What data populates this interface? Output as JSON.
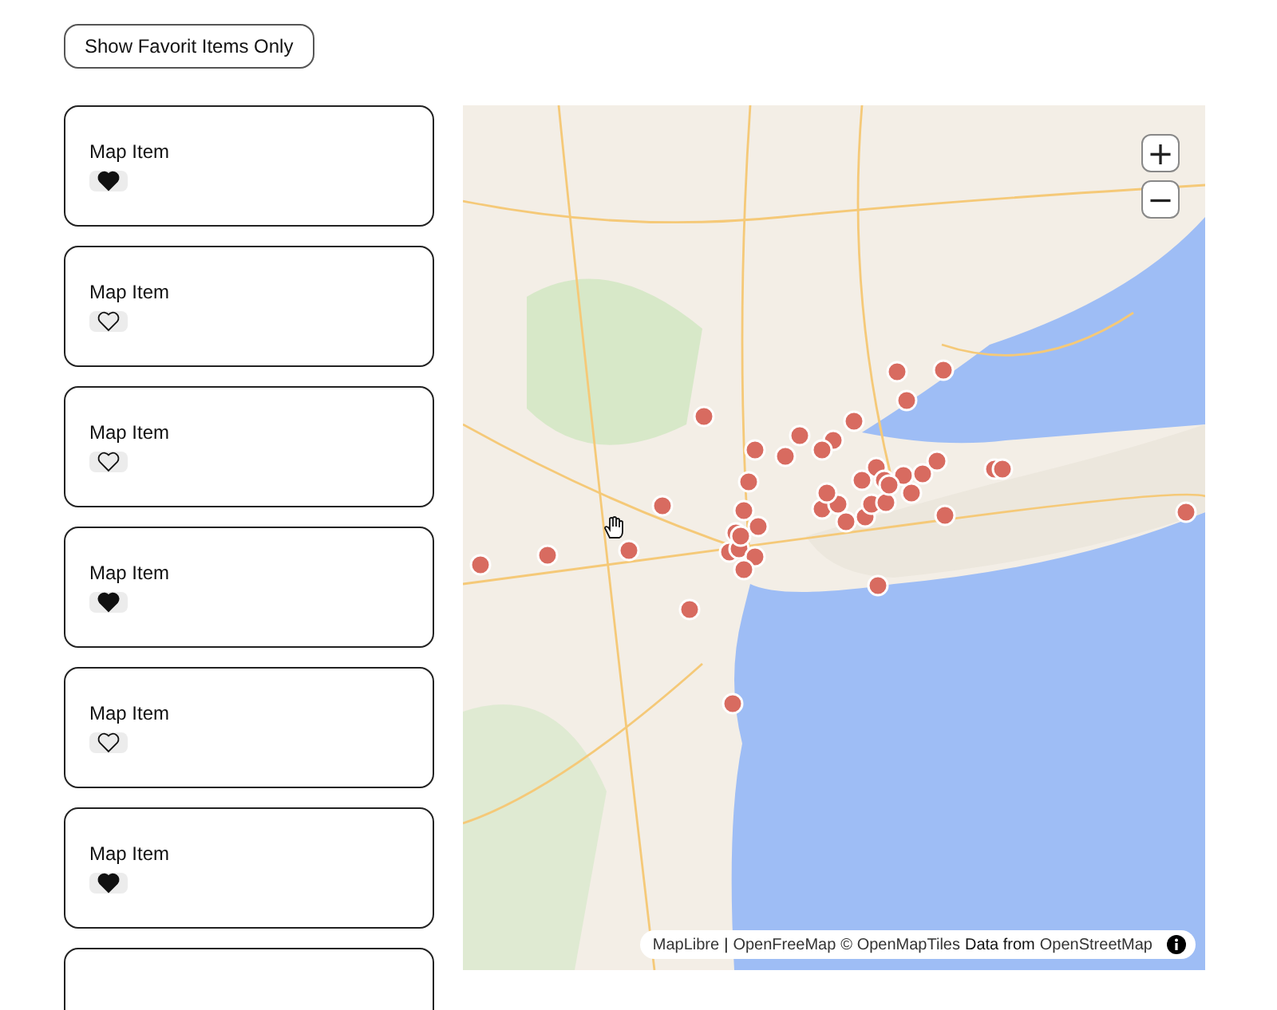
{
  "filter_button": {
    "label": "Show Favorit Items Only"
  },
  "items": [
    {
      "label": "Map Item",
      "favorite": true
    },
    {
      "label": "Map Item",
      "favorite": false
    },
    {
      "label": "Map Item",
      "favorite": false
    },
    {
      "label": "Map Item",
      "favorite": true
    },
    {
      "label": "Map Item",
      "favorite": false
    },
    {
      "label": "Map Item",
      "favorite": true
    }
  ],
  "more_items_below": true,
  "map": {
    "zoom_in": "+",
    "zoom_out": "−",
    "attribution": [
      {
        "kind": "link",
        "text": "MapLibre"
      },
      {
        "kind": "text",
        "text": "|"
      },
      {
        "kind": "link",
        "text": "OpenFreeMap"
      },
      {
        "kind": "link",
        "text": "© OpenMapTiles"
      },
      {
        "kind": "text",
        "text": "Data from"
      },
      {
        "kind": "link",
        "text": "OpenStreetMap"
      }
    ]
  }
}
